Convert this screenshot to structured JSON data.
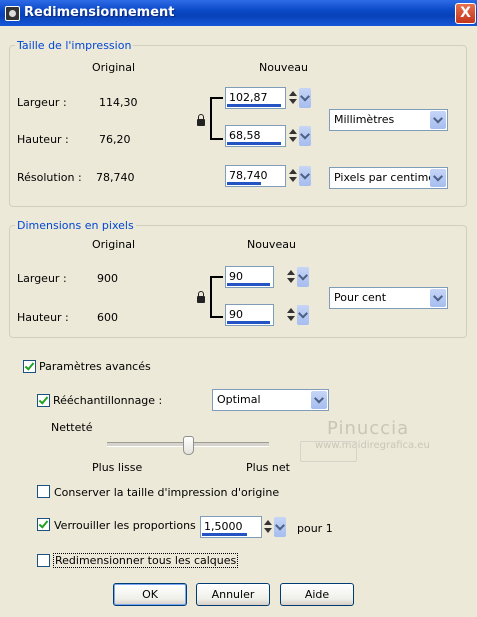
{
  "window": {
    "title": "Redimensionnement",
    "close": "X"
  },
  "print_size": {
    "legend": "Taille de l'impression",
    "col_original": "Original",
    "col_new": "Nouveau",
    "width_label": "Largeur :",
    "width_original": "114,30",
    "width_new": "102,87",
    "height_label": "Hauteur :",
    "height_original": "76,20",
    "height_new": "68,58",
    "units": "Millimètres",
    "resolution_label": "Résolution :",
    "resolution_original": "78,740",
    "resolution_new": "78,740",
    "resolution_units": "Pixels par centimètre"
  },
  "pixel_size": {
    "legend": "Dimensions en pixels",
    "col_original": "Original",
    "col_new": "Nouveau",
    "width_label": "Largeur :",
    "width_original": "900",
    "width_new": "90",
    "height_label": "Hauteur :",
    "height_original": "600",
    "height_new": "90",
    "units": "Pour cent"
  },
  "advanced": {
    "label": "Paramètres avancés",
    "checked": true,
    "resample_label": "Rééchantillonnage :",
    "resample_checked": true,
    "resample_method": "Optimal",
    "sharpness_label": "Netteté",
    "sharpness_level": 0.5,
    "slider_left": "Plus lisse",
    "slider_right": "Plus net",
    "keep_print_size_label": "Conserver la taille d'impression d'origine",
    "keep_print_size_checked": false,
    "lock_ratio_label": "Verrouiller les proportions :",
    "lock_ratio_checked": true,
    "ratio_value": "1,5000",
    "ratio_suffix": "pour 1",
    "resize_all_layers_label": "Redimensionner tous les calques",
    "resize_all_layers_checked": false
  },
  "buttons": {
    "ok": "OK",
    "cancel": "Annuler",
    "help": "Aide"
  },
  "watermark": {
    "line1": "Pinuccia",
    "line2": "www.maidiregrafica.eu"
  }
}
